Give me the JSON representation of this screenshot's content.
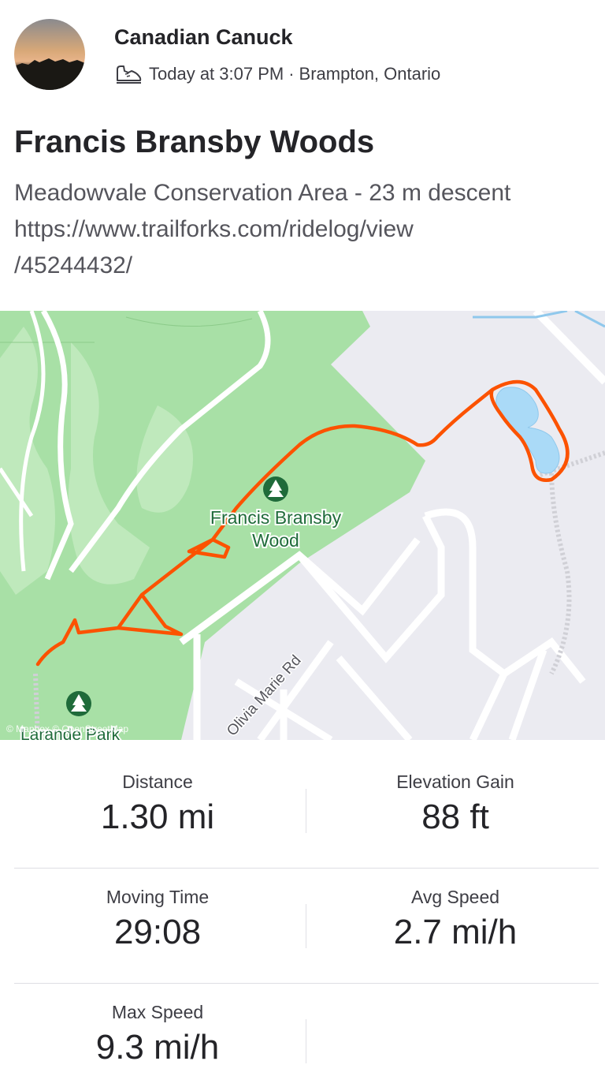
{
  "header": {
    "athlete_name": "Canadian Canuck",
    "activity_icon": "hiking-shoe-icon",
    "timestamp": "Today at 3:07 PM",
    "separator": "·",
    "location": "Brampton, Ontario"
  },
  "activity": {
    "title": "Francis Bransby Woods",
    "description_lines": [
      "Meadowvale Conservation Area - 23 m descent",
      "https://www.trailforks.com/ridelog/view",
      "/45244432/"
    ]
  },
  "map": {
    "labels": {
      "park_north_line1": "Francis Bransby",
      "park_north_line2": "Wood",
      "park_south": "Larande Park",
      "street": "Olivia Marie Rd",
      "attribution": "© Mapbox © OpenStreetMap"
    },
    "route_color": "#fc5200",
    "park_color": "#a8e0a6",
    "water_color": "#aadaf7"
  },
  "stats": [
    {
      "label": "Distance",
      "value": "1.30 mi"
    },
    {
      "label": "Elevation Gain",
      "value": "88 ft"
    },
    {
      "label": "Moving Time",
      "value": "29:08"
    },
    {
      "label": "Avg Speed",
      "value": "2.7 mi/h"
    },
    {
      "label": "Max Speed",
      "value": "9.3 mi/h"
    }
  ]
}
